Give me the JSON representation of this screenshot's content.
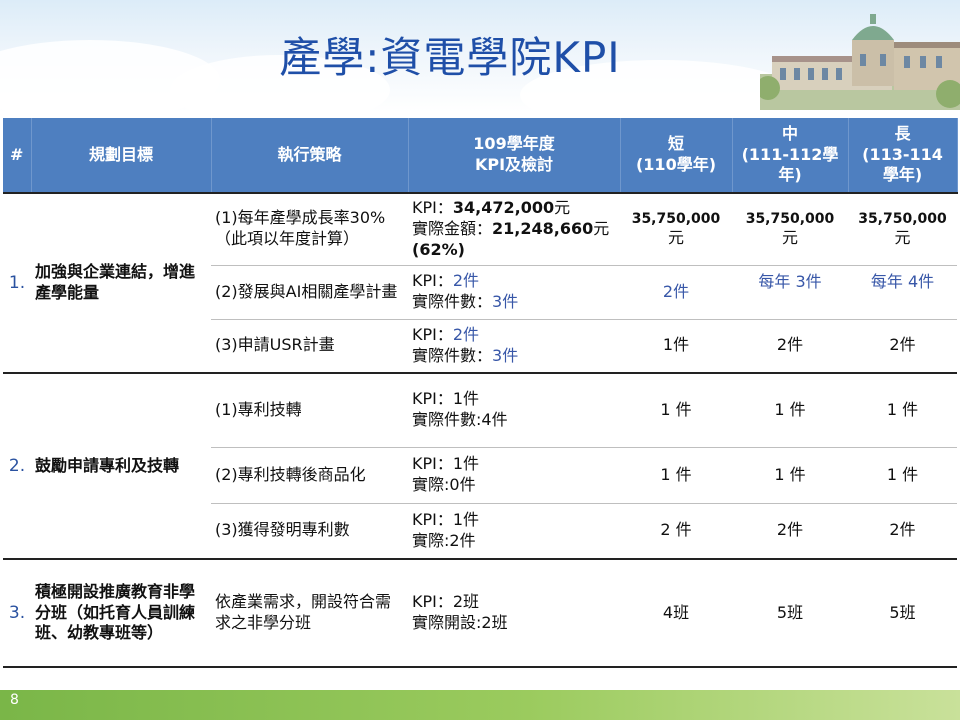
{
  "slide": {
    "title": "產學:資電學院KPI",
    "page_number": "8"
  },
  "table": {
    "headers": {
      "num": "#",
      "goal": "規劃目標",
      "strategy": "執行策略",
      "kpi_l1": "109學年度",
      "kpi_l2": "KPI及檢討",
      "short_l1": "短",
      "short_l2": "(110學年)",
      "mid_l1": "中",
      "mid_l2": "(111-112學",
      "mid_l3": "年)",
      "long_l1": "長",
      "long_l2": "(113-114",
      "long_l3": "學年)"
    },
    "groups": [
      {
        "num": "1.",
        "goal": "加強與企業連結，增進產學能量",
        "rows": [
          {
            "strategy": "(1)每年產學成長率30%（此項以年度計算）",
            "kpi_a_label": "KPI：",
            "kpi_a_value": "34,472,000",
            "kpi_a_unit": "元",
            "kpi_b_label": "實際金額：",
            "kpi_b_value": "21,248,660",
            "kpi_b_unit": "元",
            "kpi_b_pct": "(62%)",
            "short_l1": "35,750,000",
            "short_l2": "元",
            "mid_l1": "35,750,000",
            "mid_l2": "元",
            "long_l1": "35,750,000",
            "long_l2": "元"
          },
          {
            "strategy": "(2)發展與AI相關產學計畫",
            "kpi_a_label": "KPI：",
            "kpi_a_value": "2件",
            "kpi_b_label": "實際件數：",
            "kpi_b_value": "3件",
            "short": "2件",
            "mid": "每年 3件",
            "long": "每年 4件"
          },
          {
            "strategy": "(3)申請USR計畫",
            "kpi_a_label": "KPI：",
            "kpi_a_value": "2件",
            "kpi_b_label": "實際件數：",
            "kpi_b_value": "3件",
            "short": "1件",
            "mid": "2件",
            "long": "2件"
          }
        ]
      },
      {
        "num": "2.",
        "goal": "鼓勵申請專利及技轉",
        "rows": [
          {
            "strategy": "(1)專利技轉",
            "kpi_a": "KPI：1件",
            "kpi_b": "實際件數:4件",
            "short": "1 件",
            "mid": "1 件",
            "long": "1 件"
          },
          {
            "strategy": "(2)專利技轉後商品化",
            "kpi_a": "KPI：1件",
            "kpi_b": "實際:0件",
            "short": "1 件",
            "mid": "1 件",
            "long": "1 件"
          },
          {
            "strategy": "(3)獲得發明專利數",
            "kpi_a": "KPI：1件",
            "kpi_b": "實際:2件",
            "short": "2 件",
            "mid": "2件",
            "long": "2件"
          }
        ]
      },
      {
        "num": "3.",
        "goal": "積極開設推廣教育非學分班（如托育人員訓練班、幼教專班等）",
        "rows": [
          {
            "strategy": "依產業需求，開設符合需求之非學分班",
            "kpi_a": "KPI：2班",
            "kpi_b": "實際開設:2班",
            "short": "4班",
            "mid": "5班",
            "long": "5班"
          }
        ]
      }
    ]
  },
  "colors": {
    "title": "#1f4fa8",
    "header_bg": "#4e7fc0",
    "accent_blue": "#3857a8",
    "footer_green": "#7ab648"
  },
  "icons": {
    "header_decoration": "building-illustration"
  }
}
